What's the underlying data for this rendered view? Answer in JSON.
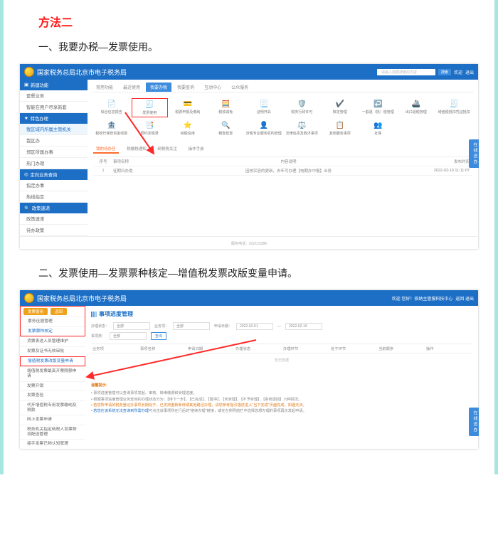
{
  "doc": {
    "section_title": "方法二",
    "step1_text": "一、我要办税—发票使用。",
    "step2_text": "二、发票使用—发票票种核定—增值税发票改版变量申请。"
  },
  "shot1": {
    "header_title": "国家税务总局北京市电子税务局",
    "search_placeholder": "请输入需要搜索的内容",
    "search_btn": "搜索",
    "welcome": "欢迎",
    "logout": "退出",
    "sidebar": {
      "sec1": "新建功能",
      "s1_items": [
        "套餐业务",
        "智能在用户尽享新套"
      ],
      "sec2": "特色办理",
      "s2_items": [
        "我区域内所属主管机关",
        "我区办",
        "郑区所属办事",
        "热门办理"
      ],
      "sec3": "定向业务查询",
      "s3_items": [
        "指定办事",
        "热线指定"
      ],
      "sec4": "政策速递",
      "s4_items": [
        "政策速递",
        "待办政策"
      ]
    },
    "tabs": [
      "常用功能",
      "最近使用",
      "我要办税",
      "我要查询",
      "互动中心",
      "公众服务"
    ],
    "apps_row1": [
      "综合信息报告",
      "发票使用",
      "税费申报及缴纳",
      "税收减免",
      "证明开具",
      "税务行政许可",
      "核定管理",
      "一般退（抵）税管理",
      "出口退税管理",
      "增值税抵扣凭证抵扣",
      "税收代保管资金收取"
    ],
    "apps_row2": [
      "预约定税录",
      "纳税信用",
      "稽查检查",
      "涉税专业服务机构管理",
      "法律追责及救济事项",
      "其他服务事项",
      "社保"
    ],
    "table_tabs": [
      "我的待办任",
      "税缴税通知",
      "纳税税关注",
      "操作手册"
    ],
    "cols": [
      "序号",
      "事项名称",
      "内容说明",
      "发布时间"
    ],
    "row": {
      "idx": "1",
      "name": "征期扫办提",
      "desc": "因核实容的更新，去年可办理【电期办中报】业务",
      "time": "2022-02-10 11:11:07"
    },
    "footer": "服务电话：022123386",
    "floater": "在线咨办"
  },
  "shot2": {
    "header_title": "国家税务总局北京市电子税务局",
    "header_right": "欢迎 您好！依纳主管报科技中心",
    "logout": "返回 退出",
    "sidebar": {
      "top_btns": [
        "发票使用",
        "返回"
      ],
      "items": [
        "票务征据管理",
        "发票票种核定",
        "货票表述人员管理维护",
        "发票及证书无效审批",
        "增值税发票改版变量申请",
        "增值税发票最高开票限额申请",
        "发票开销",
        "发票查验",
        "代开增值税专用发票缴纳及税款",
        "网上发票申请",
        "税务机关指定纳税人发票物流配送管理",
        "接手发票已物认知管理"
      ]
    },
    "panel_title": "事项进度管理",
    "filters": {
      "l1": "办理状态：",
      "v1": "全部",
      "l2": "业务项：",
      "v2": "全部",
      "l3": "申请日期：",
      "d1": "2022-02-01",
      "dash": "—",
      "d2": "2022-02-10",
      "l4": "事项类：",
      "v4": "全部",
      "btn": "查询"
    },
    "thead": [
      "业务项",
      "事项名称",
      "申请日期",
      "办理状态",
      "办理环节",
      "处于环节",
      "当前顺序",
      "操作"
    ],
    "empty": "暂无数据",
    "tips_title": "温馨提示：",
    "tips": [
      "事项进度管理可以查询事项发起、审核、转维缴费和受理进度。",
      "根据事项进度管理业务查询的办理状态分为：【待下一步】、【已完成】、【暂停】、【未受理】、【不予受理】、【系统退回】六种情况。",
      "若您所申请的税务登记办事项长期处于，已支持重新新增或其他路径办理，请您参考指引描述进入\"当下完成\"页面完成，如遇无法。",
      "若您在该系统无法查询到所需办理",
      "可点击该事项所在行后的\"继续办理\"链接，或在左侧导航栏中选择您想办理的事项再次发起申请。"
    ],
    "floater": "在线咨办"
  }
}
